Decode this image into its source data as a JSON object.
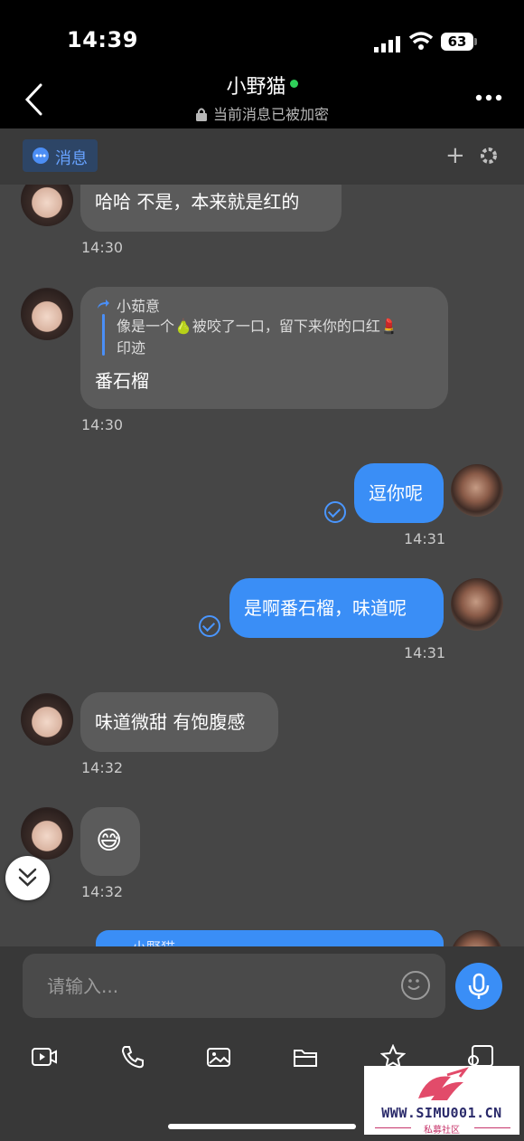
{
  "status_bar": {
    "time": "14:39",
    "battery": "63"
  },
  "header": {
    "title": "小野猫",
    "subtitle": "当前消息已被加密"
  },
  "toolbar": {
    "tab_label": "消息",
    "plus": "+"
  },
  "messages": [
    {
      "side": "left",
      "text": "哈哈 不是，本来就是红的",
      "time": "14:30"
    },
    {
      "side": "left",
      "quote_author": "小茹意",
      "quote_text_line1": "像是一个🍐被咬了一口，留下来你的口红💄",
      "quote_text_line2": "印迹",
      "text": "番石榴",
      "time": "14:30"
    },
    {
      "side": "right",
      "text": "逗你呢",
      "time": "14:31"
    },
    {
      "side": "right",
      "text": "是啊番石榴，味道呢",
      "time": "14:31"
    },
    {
      "side": "left",
      "text": "味道微甜 有饱腹感",
      "time": "14:32"
    },
    {
      "side": "left",
      "text": "😅",
      "time": "14:32"
    },
    {
      "side": "right",
      "quote_author": "小野猫",
      "text": ""
    }
  ],
  "input": {
    "placeholder": "请输入..."
  },
  "bottom_tools": [
    "video-icon",
    "phone-icon",
    "image-icon",
    "folder-icon",
    "star-icon",
    "search-doc-icon"
  ],
  "watermark": {
    "text": "WWW.SIMU001.CN",
    "sub": "私募社区"
  },
  "colors": {
    "accent": "#3a8ef6",
    "chat_bg": "#464646",
    "incoming_bubble": "#5b5b5b",
    "online": "#2fd05a"
  }
}
